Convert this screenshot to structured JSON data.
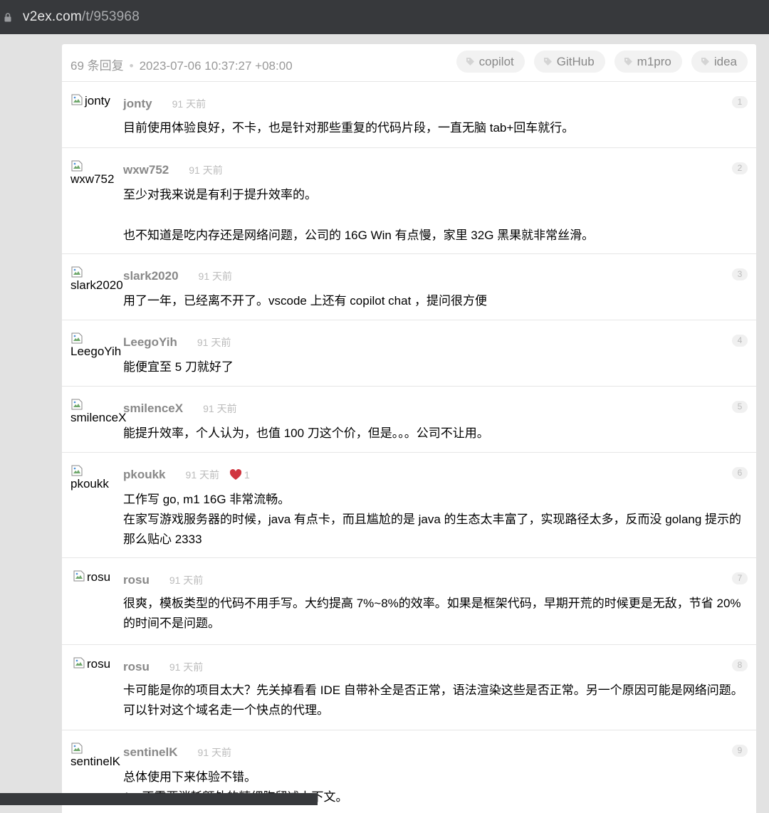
{
  "browser": {
    "url_host": "v2ex.com",
    "url_path": "/t/953968"
  },
  "topic": {
    "reply_count": "69 条回复",
    "separator": "•",
    "timestamp": "2023-07-06 10:37:27 +08:00",
    "tags": [
      "copilot",
      "GitHub",
      "m1pro",
      "idea"
    ]
  },
  "replies": [
    {
      "avatar_alt": "jonty",
      "username": "jonty",
      "time": "91 天前",
      "floor": "1",
      "lines": [
        "目前使用体验良好，不卡，也是针对那些重复的代码片段，一直无脑 tab+回车就行。"
      ]
    },
    {
      "avatar_alt": "wxw752",
      "username": "wxw752",
      "time": "91 天前",
      "floor": "2",
      "lines": [
        "至少对我来说是有利于提升效率的。",
        "也不知道是吃内存还是网络问题，公司的 16G Win 有点慢，家里 32G 黑果就非常丝滑。"
      ]
    },
    {
      "avatar_alt": "slark2020",
      "username": "slark2020",
      "time": "91 天前",
      "floor": "3",
      "lines": [
        "用了一年，已经离不开了。vscode 上还有 copilot chat ，提问很方便"
      ]
    },
    {
      "avatar_alt": "LeegoYih",
      "username": "LeegoYih",
      "time": "91 天前",
      "floor": "4",
      "lines": [
        "能便宜至 5 刀就好了"
      ]
    },
    {
      "avatar_alt": "smilenceX",
      "username": "smilenceX",
      "time": "91 天前",
      "floor": "5",
      "lines": [
        "能提升效率，个人认为，也值 100 刀这个价，但是。。。公司不让用。"
      ]
    },
    {
      "avatar_alt": "pkoukk",
      "username": "pkoukk",
      "time": "91 天前",
      "thanks": "1",
      "floor": "6",
      "lines": [
        "工作写 go, m1 16G 非常流畅。",
        "在家写游戏服务器的时候，java 有点卡，而且尴尬的是 java 的生态太丰富了，实现路径太多，反而没 golang 提示的那么贴心 2333"
      ]
    },
    {
      "avatar_alt": "rosu",
      "username": "rosu",
      "time": "91 天前",
      "floor": "7",
      "lines": [
        "很爽，模板类型的代码不用手写。大约提高 7%~8%的效率。如果是框架代码，早期开荒的时候更是无敌，节省 20% 的时间不是问题。"
      ]
    },
    {
      "avatar_alt": "rosu",
      "username": "rosu",
      "time": "91 天前",
      "floor": "8",
      "lines": [
        "卡可能是你的项目太大？先关掉看看 IDE 自带补全是否正常，语法渲染这些是否正常。另一个原因可能是网络问题。可以针对这个域名走一个快点的代理。"
      ]
    },
    {
      "avatar_alt": "sentinelK",
      "username": "sentinelK",
      "time": "91 天前",
      "floor": "9",
      "lines": [
        "总体使用下来体验不错。",
        "1、不需要消耗额外的精细胸留述上下文。"
      ]
    }
  ]
}
